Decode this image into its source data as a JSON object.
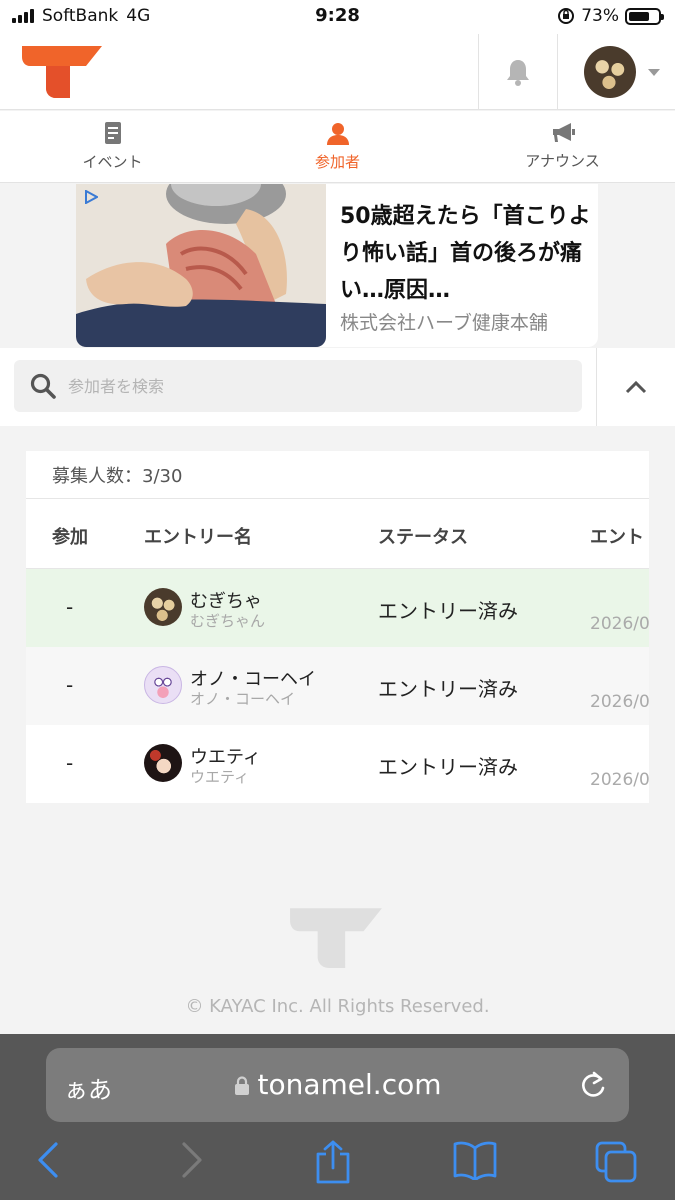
{
  "status_bar": {
    "carrier": "SoftBank",
    "network": "4G",
    "time": "9:28",
    "battery": "73%",
    "battery_level": 0.73
  },
  "header": {
    "brand_color": "#f0642a",
    "bell_icon": "bell-icon",
    "avatar_icon": "user-avatar"
  },
  "tabs": [
    {
      "label": "イベント",
      "icon": "document-icon",
      "active": false
    },
    {
      "label": "参加者",
      "icon": "person-icon",
      "active": true
    },
    {
      "label": "アナウンス",
      "icon": "megaphone-icon",
      "active": false
    }
  ],
  "ad": {
    "title": "50歳超えたら「首こりより怖い話」首の後ろが痛い…原因…",
    "sponsor": "株式会社ハーブ健康本舗"
  },
  "search": {
    "placeholder": "参加者を検索",
    "value": ""
  },
  "table": {
    "recruit_label": "募集人数：3/30",
    "headers": [
      "参加",
      "エントリー名",
      "ステータス",
      "エント"
    ],
    "rows": [
      {
        "join": "-",
        "name": "むぎちゃ",
        "sub": "むぎちゃん",
        "status": "エントリー済み",
        "date": "2026/0",
        "highlight": "#eaf6e8"
      },
      {
        "join": "-",
        "name": "オノ・コーヘイ",
        "sub": "オノ・コーヘイ",
        "status": "エントリー済み",
        "date": "2026/0",
        "highlight": "#f7f7f7"
      },
      {
        "join": "-",
        "name": "ウエティ",
        "sub": "ウエティ",
        "status": "エントリー済み",
        "date": "2026/0",
        "highlight": "#ffffff"
      }
    ]
  },
  "footer": {
    "copyright": "© KAYAC Inc. All Rights Reserved."
  },
  "browser": {
    "aa_label": "ぁあ",
    "url": "tonamel.com"
  }
}
